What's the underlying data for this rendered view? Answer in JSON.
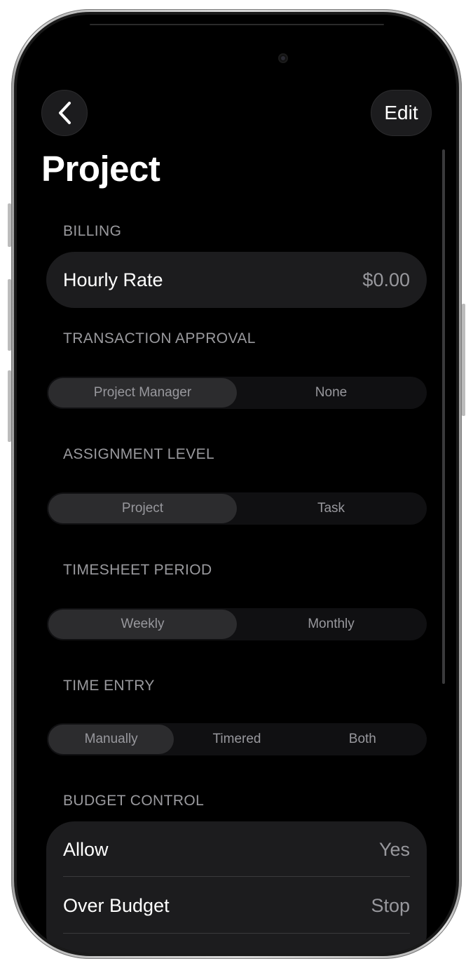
{
  "nav": {
    "back_icon": "chevron-left-icon",
    "edit_label": "Edit"
  },
  "page": {
    "title": "Project"
  },
  "billing": {
    "header": "BILLING",
    "hourly_rate_label": "Hourly Rate",
    "hourly_rate_value": "$0.00"
  },
  "transaction_approval": {
    "header": "TRANSACTION APPROVAL",
    "options": [
      "Project Manager",
      "None"
    ],
    "selected": "Project Manager"
  },
  "assignment_level": {
    "header": "ASSIGNMENT LEVEL",
    "options": [
      "Project",
      "Task"
    ],
    "selected": "Project"
  },
  "timesheet_period": {
    "header": "TIMESHEET PERIOD",
    "options": [
      "Weekly",
      "Monthly"
    ],
    "selected": "Weekly"
  },
  "time_entry": {
    "header": "TIME ENTRY",
    "options": [
      "Manually",
      "Timered",
      "Both"
    ],
    "selected": "Manually"
  },
  "budget_control": {
    "header": "BUDGET CONTROL",
    "allow_label": "Allow",
    "allow_value": "Yes",
    "over_budget_label": "Over Budget",
    "over_budget_value": "Stop"
  },
  "colors": {
    "background": "#000000",
    "card": "#1c1c1e",
    "segment_selected": "#2c2c2e",
    "secondary_text": "#98989d"
  }
}
